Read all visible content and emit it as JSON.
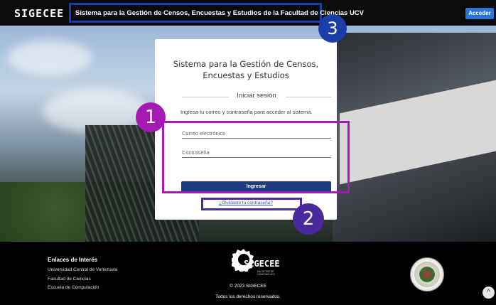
{
  "header": {
    "brand": "SIGECEE",
    "title": "Sistema para la Gestión de Censos, Encuestas y Estudios de la Facultad de Ciencias UCV",
    "login_button": "Acceder"
  },
  "login_card": {
    "title_line1": "Sistema para la Gestión de Censos,",
    "title_line2": "Encuestas y Estudios",
    "section_label": "Iniciar sesión",
    "instructions": "Ingresa tu correo y contraseña para acceder al sistema.",
    "email_placeholder": "Correo electrónico",
    "password_placeholder": "Contraseña",
    "submit_label": "Ingresar",
    "forgot_link": "¿Olvidaste tu contraseña?"
  },
  "annotations": {
    "one": "1",
    "two": "2",
    "three": "3"
  },
  "footer": {
    "links_title": "Enlaces de Interés",
    "links": [
      "Universidad Central de Venezuela",
      "Facultad de Ciencias",
      "Escuela de Computación"
    ],
    "logo_text": "SIGECEE",
    "logo_sub": "FACULTAD DE CIENCIAS UCV",
    "copyright": "© 2023 SIGECEE",
    "rights": "Todos los derechos reservados.",
    "scroll_top_icon": "^"
  },
  "colors": {
    "nav_bg": "#0b0b0b",
    "accent_blue": "#2a73d9",
    "submit_blue": "#1c3d82",
    "annotation_purple": "#a51ab3",
    "annotation_navy": "#1a3fa8"
  }
}
